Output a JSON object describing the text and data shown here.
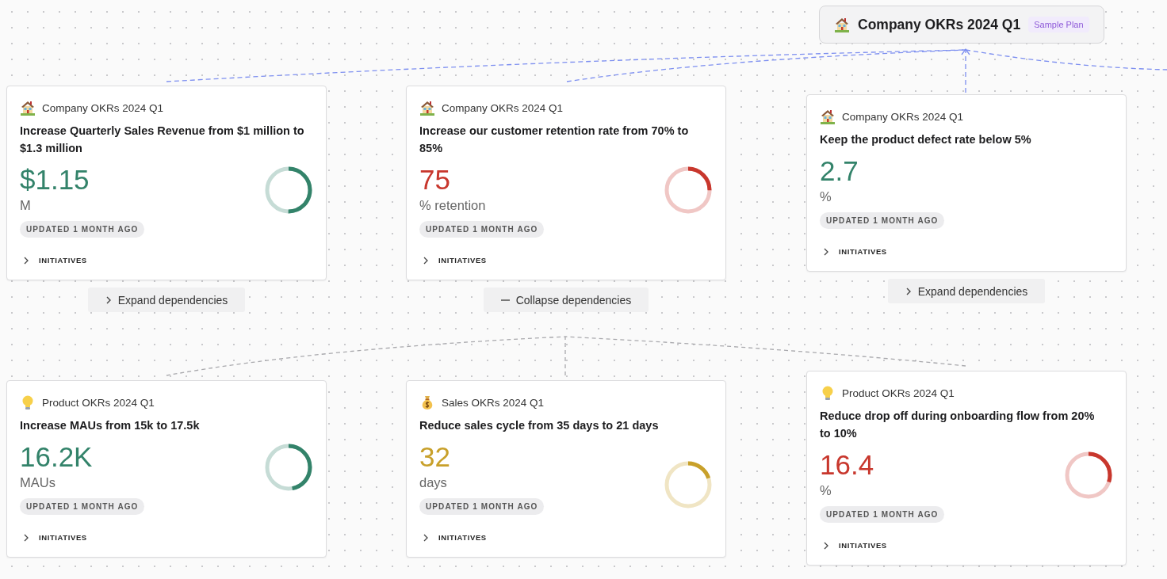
{
  "plan_header": {
    "kind": "company",
    "title": "Company OKRs 2024 Q1",
    "badge": "Sample Plan"
  },
  "objectives": [
    {
      "plan": {
        "kind": "company",
        "name": "Company OKRs 2024 Q1"
      },
      "title": "Increase Quarterly Sales Revenue from $1 million to $1.3 million",
      "value": "$1.15",
      "unit": "M",
      "color": "#33836a",
      "level": 0.5,
      "updated": "UPDATED 1 MONTH AGO",
      "initiatives": {
        "label": "INITIATIVES",
        "expanded": false
      },
      "dependencies": {
        "label": "Expand dependencies",
        "expanded": false
      }
    },
    {
      "plan": {
        "kind": "company",
        "name": "Company OKRs 2024 Q1"
      },
      "title": "Increase our customer retention rate from 70% to 85%",
      "value": "75",
      "unit": "% retention",
      "color": "#c8372d",
      "level": 0.25,
      "updated": "UPDATED 1 MONTH AGO",
      "initiatives": {
        "label": "INITIATIVES",
        "expanded": false
      },
      "dependencies": {
        "label": "Collapse dependencies",
        "expanded": true
      }
    },
    {
      "plan": {
        "kind": "company",
        "name": "Company OKRs 2024 Q1"
      },
      "title": "Keep the product defect rate below 5%",
      "value": "2.7",
      "unit": "%",
      "color": "#33836a",
      "updated": "UPDATED 1 MONTH AGO",
      "initiatives": {
        "label": "INITIATIVES",
        "expanded": false
      },
      "dependencies": {
        "label": "Expand dependencies",
        "expanded": false
      }
    }
  ],
  "dependent_objectives": [
    {
      "plan": {
        "kind": "product",
        "name": "Product OKRs 2024 Q1"
      },
      "title": "Increase MAUs from 15k to 17.5k",
      "value": "16.2K",
      "unit": "MAUs",
      "color": "#33836a",
      "level": 0.47,
      "updated": "UPDATED 1 MONTH AGO",
      "initiatives": {
        "label": "INITIATIVES",
        "expanded": false
      }
    },
    {
      "plan": {
        "kind": "sales",
        "name": "Sales OKRs 2024 Q1"
      },
      "title": "Reduce sales cycle from 35 days to 21 days",
      "value": "32",
      "unit": "days",
      "color": "#c8a02a",
      "level": 0.2,
      "updated": "UPDATED 1 MONTH AGO",
      "initiatives": {
        "label": "INITIATIVES",
        "expanded": false
      }
    },
    {
      "plan": {
        "kind": "product",
        "name": "Product OKRs 2024 Q1"
      },
      "title": "Reduce drop off during onboarding flow from 20% to 10%",
      "value": "16.4",
      "unit": "%",
      "color": "#c8372d",
      "level": 0.3,
      "updated": "UPDATED 1 MONTH AGO",
      "initiatives": {
        "label": "INITIATIVES",
        "expanded": false
      }
    }
  ]
}
